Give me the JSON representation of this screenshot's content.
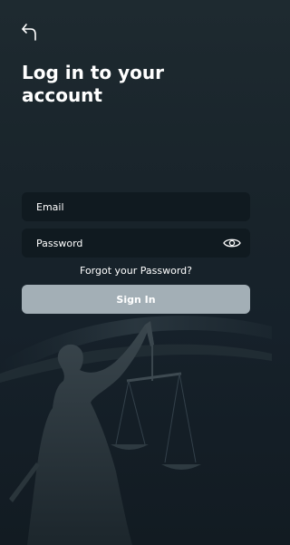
{
  "header": {
    "back_icon": "back-arrow-icon"
  },
  "title": "Log in to your account",
  "form": {
    "email_placeholder": "Email",
    "password_placeholder": "Password",
    "show_password_icon": "eye-icon",
    "forgot_label": "Forgot your Password?",
    "signin_label": "Sign In"
  },
  "colors": {
    "background": "#1a252b",
    "field_background": "#101a20",
    "button_background": "#a3afb6",
    "text": "#ffffff"
  },
  "background_image": "lady-justice-statue"
}
